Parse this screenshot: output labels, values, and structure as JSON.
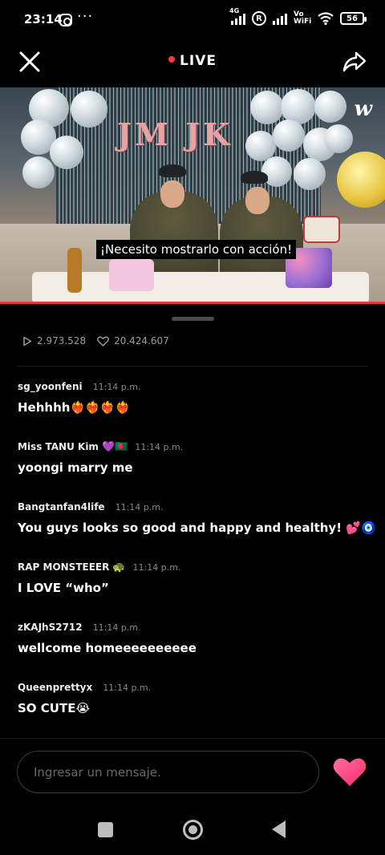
{
  "status_bar": {
    "time": "23:14",
    "network": "4G",
    "vowifi": "Vo WiFi",
    "battery": "56"
  },
  "header": {
    "live_label": "LIVE"
  },
  "video": {
    "subtitle": "¡Necesito mostrarlo con acción!",
    "logo": "w",
    "letters": "JM JK"
  },
  "stats": {
    "plays": "2.973.528",
    "likes": "20.424.607"
  },
  "comments": [
    {
      "user": "sg_yoonfeni",
      "badge": "",
      "time": "11:14 p.m.",
      "text": "Hehhhh❤️‍🔥❤️‍🔥❤️‍🔥❤️‍🔥"
    },
    {
      "user": "Miss TANU Kim",
      "badge": "💜🇧🇩",
      "time": "11:14 p.m.",
      "text": "yoongi marry me"
    },
    {
      "user": "Bangtanfan4life",
      "badge": "",
      "time": "11:14 p.m.",
      "text": "You guys looks so good and happy and healthy! 💕🧿"
    },
    {
      "user": "RAP MONSTEEER",
      "badge": "🐢",
      "time": "11:14 p.m.",
      "text": "I LOVE “who”"
    },
    {
      "user": "zKAJhS2712",
      "badge": "",
      "time": "11:14 p.m.",
      "text": "wellcome homeeeeeeeeee"
    },
    {
      "user": "Queenprettyx",
      "badge": "",
      "time": "11:14 p.m.",
      "text": "SO CUTE😭"
    }
  ],
  "composer": {
    "placeholder": "Ingresar un mensaje."
  },
  "colors": {
    "accent_red": "#e53a3a",
    "heart_pink": "#ff3d7f"
  }
}
